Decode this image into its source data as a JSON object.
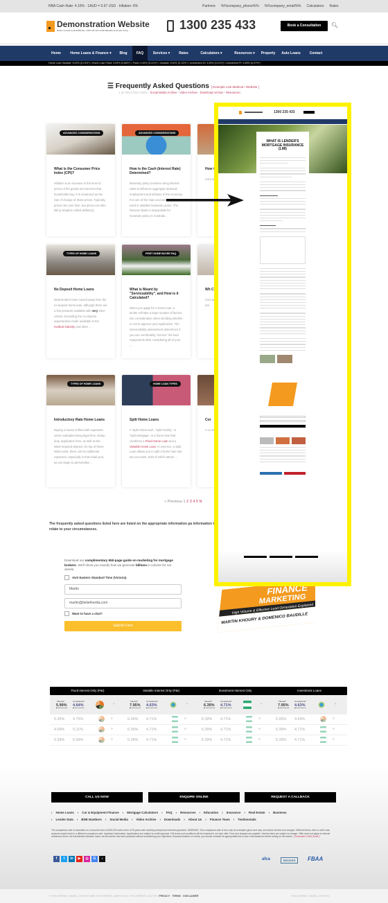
{
  "topbar": {
    "left": "RBA Cash Rate: 4.10% · 1AUD = 0.67 USD · Inflation: 6%",
    "links": [
      "Partners",
      "%%company_phone%%",
      "%%company_email%%",
      "Calculators",
      "Rates"
    ]
  },
  "header": {
    "logo_title": "Demonstration Website",
    "logo_subtitle": "Broker Growth by BeliefMedia | 1300 235 433 (1300 BELIEF) Example Group",
    "phone": "1300 235 433",
    "book_button": "Book a Consultation",
    "search_icon": "search-icon"
  },
  "nav": {
    "items": [
      "Home",
      "Home Loans & Finance ▾",
      "Blog",
      "FAQ",
      "Services ▾",
      "Rates",
      "Calculators ▾",
      "Resources ▾",
      "Property",
      "Auto Loans",
      "Contact"
    ],
    "active": "FAQ",
    "ticker": "Home Loan Variable: 5.00% (5.13%*) • Home Loan Fixed: 5.09% (5.68%*) • Fixed: 4.69% (5.11%*) • Variable: 5.00% (5.13%*) • Investment IO: 4.69% (5.11%*) • Investment PI: 4.89% (6.47%*)",
    "color": "#203a68"
  },
  "page": {
    "title": "Frequently Asked Questions",
    "title_links": "[ Example Link Medical • Website ]",
    "related_label": "RELATED LINKS",
    "related_links": [
      "Social Media Archive",
      "Video Archive",
      "Download Archive",
      "Resources"
    ]
  },
  "cards": [
    {
      "badge": "ADVANCED CONSIDERATIONS",
      "title": "What is the Consumer Price Index (CPI)?",
      "text": "Inflation is an increase in the level of prices of the goods and services that households buy. It is measured as the rate of change of those prices. Typically, prices rise over time, but prices can also fall (a situation called deflation)."
    },
    {
      "badge": "ADVANCED CONSIDERATIONS",
      "title": "How is the Cash (Interest Rate) Determined?",
      "text": "Monetary policy involves using interest rates to influence aggregate demand, employment and inflation in the economy. It is one of the main economic policies used to stabilise business cycles. The Reserve Bank is responsible for monetary policy in Australia ..."
    },
    {
      "badge": "",
      "title": "How Calc",
      "text": "Com addi prin inter inter whe"
    },
    {
      "badge": "TYPES OF HOME LOANS",
      "title": "No Deposit Home Loans",
      "text_a": "Most lenders have moved away from the no-deposit home loan, although there are a few products available with ",
      "bold": "very",
      "text_b": " strict criteria. Excluding the no-deposit opportunities made available to the ",
      "link": "medical industry",
      "text_c": " and other ..."
    },
    {
      "badge": "FIRST HOME BUYER FAQ",
      "title": "What is Meant by \"Serviceability\", and How is it Calculated?",
      "text": "When you apply for a home loan, a lender will take a large number of factors into consideration when deciding whether or not to approve your application. The Serviceability assessment determines if you can comfortably \"service\" the loan repayments after considering all of your ..."
    },
    {
      "badge": "",
      "title": "Wh Cor",
      "text": "Com proc orga doc tran pers com und are"
    },
    {
      "badge": "TYPES OF HOME LOANS",
      "title": "Introductory Rate Home Loans",
      "text": "Buying a house is filled with expenses, some examples being legal fees, stamp duty, application fees, as well as the initial required deposit. On top of these initial costs, there can be additional expenses, especially in that initial year, as you begin to personalise ..."
    },
    {
      "badge": "HOME LOAN TYPES",
      "title": "Split Home Loans",
      "text_a": "A 'Split Home loan', 'Split Facility', or 'Split Mortgage', is a home loan that combines a ",
      "link1": "Fixed Home Loan",
      "text_b": " and a ",
      "link2": "Variable Home Loan",
      "text_c": ". In essence, a Split Loan allows you to split a home loan into two accounts, both of which attract ..."
    },
    {
      "badge": "",
      "title": "Cor",
      "text": "A co as a opti to p fund thro buil has stru"
    }
  ],
  "pager": {
    "prev": "« Previous",
    "pages": [
      "1",
      "2",
      "3",
      "4",
      "5",
      "N"
    ]
  },
  "note": "The frequently asked questions listed here are listed on the appropriate information pa information that may relate to your circumstances.",
  "form": {
    "intro_a": "Download our ",
    "intro_b": "complimentary 650-page guide on marketing for mortgage brokers",
    "intro_c": ". We'll show you exactly how we generate ",
    "intro_d": "billions",
    "intro_e": " in volume for our clients.",
    "timezone_label": "AUS Eastern Standard Time (Victoria)",
    "name_value": "Martin",
    "email_value": "martin@beliefmedia.com",
    "chat_label": "Want to have a chat?",
    "submit": "Submit Form",
    "submit_color": "#fbbf2d"
  },
  "overlay": {
    "phone": "1300 235 433",
    "article_title": "WHAT IS LENDER'S MORTGAGE INSURANCE (LMI)",
    "border_color": "#fff200"
  },
  "book": {
    "title_a": "FINANCE",
    "title_b": "MARKETING",
    "subtitle": "High Volume & Effective Lead Generation Explained",
    "authors": "MARTIN KHOURY & DOMENICO BAUDILLE"
  },
  "rates": {
    "interest_label": "Interest*",
    "comparison_label": "Comparison*",
    "tables": [
      {
        "title": "Fixed Interest Only (P&I)",
        "interest": "5.99%",
        "comparison": "4.64%",
        "rows": [
          [
            "6.39%",
            "4.75%"
          ],
          [
            "4.69%",
            "5.11%"
          ],
          [
            "5.99%",
            "5.59%"
          ]
        ]
      },
      {
        "title": "Variable Interest Only (P&I)",
        "interest": "7.95%",
        "comparison": "4.63%",
        "rows": [
          [
            "6.39%",
            "4.71%"
          ],
          [
            "6.39%",
            "4.71%"
          ],
          [
            "6.39%",
            "4.71%"
          ]
        ]
      },
      {
        "title": "Investment Interest Only",
        "interest": "6.39%",
        "comparison": "4.71%",
        "rows": [
          [
            "6.39%",
            "4.71%"
          ],
          [
            "6.39%",
            "4.71%"
          ],
          [
            "6.39%",
            "4.71%"
          ]
        ]
      },
      {
        "title": "Investment Loans",
        "interest": "7.95%",
        "comparison": "4.63%",
        "rows": [
          [
            "5.99%",
            "4.64%"
          ],
          [
            "6.39%",
            "4.71%"
          ],
          [
            "6.39%",
            "4.71%"
          ]
        ]
      }
    ]
  },
  "footer": {
    "buttons": [
      "CALL US NOW",
      "ENQUIRE ONLINE",
      "REQUEST A CALLBACK"
    ],
    "links_row1": [
      "Home Loans",
      "Car & Equipment Finance",
      "Mortgage Calculators",
      "FAQ",
      "Resources",
      "Education",
      "Insurance",
      "Real Estate",
      "Business"
    ],
    "links_row2": [
      "Lender Data",
      "BSB Numbers",
      "Social Media",
      "Video Archive",
      "Downloads",
      "About Us",
      "Finance Team",
      "Testimonials"
    ],
    "disclaimer": "The comparison rate is calculated on a secured loan of $150,000 with a term of 25 years with monthly principal and interest payments. WARNING: This comparison rate is true only for examples given and may not include all fees and charges. Different terms, fees or other loan amounts might result in a different comparison rate. Important Information: Applications are subject to credit approval. Full terms and conditions will be included in our loan offer. Fees and charges are payable. Interest rates are subject to change. Offer does not apply to internal refinances and is not transferable between loans. As this advice has been prepared without considering your objectives, financial situation or needs, you should consider its appropriateness to your circumstances before acting on the advice.",
    "disclaimer_link": "[ Download Credit Guide ]",
    "social": [
      "f",
      "t",
      "in",
      "▶",
      "◎",
      "G",
      "♪"
    ],
    "associations": [
      "afca",
      "BROKER",
      "FBAA"
    ],
    "copyright": "© %%COMPANY_NAME_LONG%% ABN %%COMPANY_ABN%% ACL %%COMPANY_ACL%% | ",
    "legal_links": [
      "PRIVACY",
      "TERMS",
      "DISCLAIMER"
    ],
    "right": "%%COMPANY_NAME_LONG%%"
  }
}
